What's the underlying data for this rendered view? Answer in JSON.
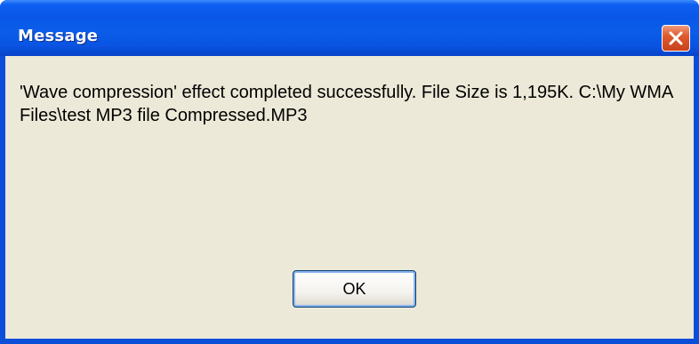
{
  "dialog": {
    "title": "Message",
    "message": "'Wave compression' effect completed successfully. File Size is 1,195K. C:\\My WMA Files\\test MP3 file Compressed.MP3",
    "ok_label": "OK"
  },
  "icons": {
    "close": "close-icon"
  },
  "colors": {
    "titlebar": "#0a57e8",
    "client_background": "#ece9d8",
    "close_button": "#e05a2e",
    "title_text": "#ffffff"
  }
}
